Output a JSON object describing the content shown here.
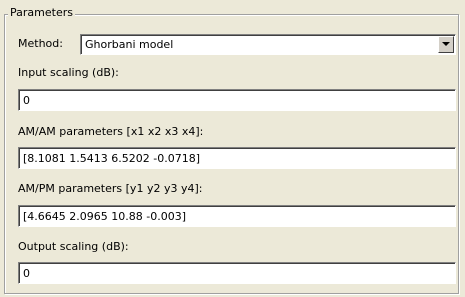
{
  "panel": {
    "title": "Parameters"
  },
  "method": {
    "label": "Method:",
    "selected": "Ghorbani model"
  },
  "fields": {
    "input_scaling": {
      "label": "Input scaling (dB):",
      "value": "0"
    },
    "am_am": {
      "label": "AM/AM parameters [x1 x2 x3 x4]:",
      "value": "[8.1081 1.5413 6.5202 -0.0718]"
    },
    "am_pm": {
      "label": "AM/PM parameters [y1 y2 y3 y4]:",
      "value": "[4.6645 2.0965 10.88 -0.003]"
    },
    "output_scaling": {
      "label": "Output scaling (dB):",
      "value": "0"
    }
  },
  "icons": {
    "dropdown": "chevron-down-icon"
  },
  "colors": {
    "background": "#ece9d8",
    "field_background": "#ffffff",
    "border_dark": "#808080"
  }
}
